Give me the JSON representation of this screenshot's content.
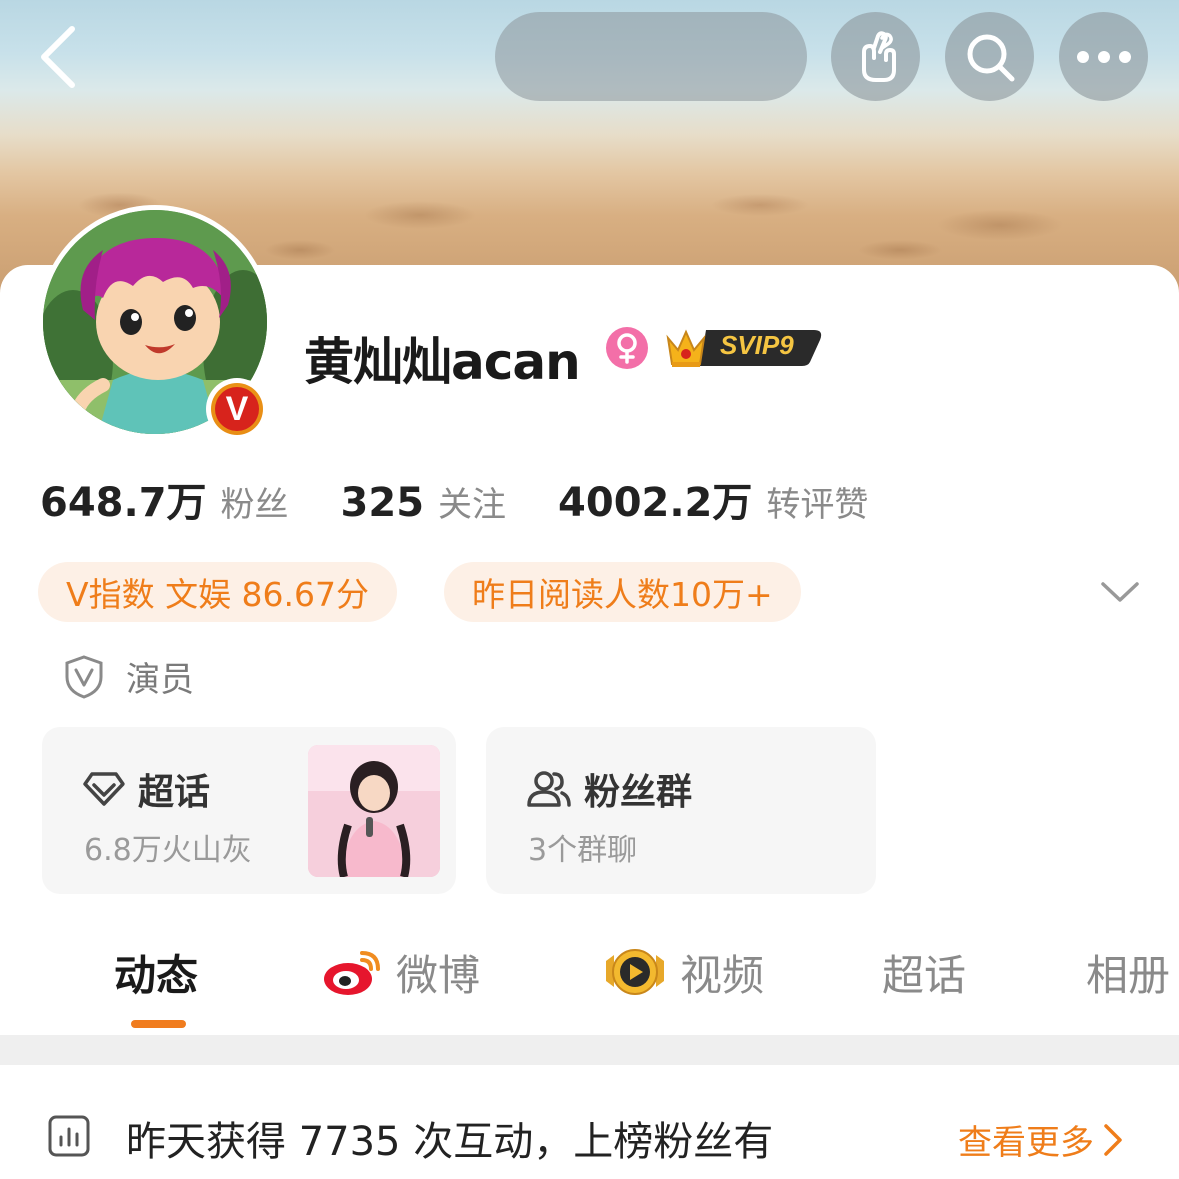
{
  "header": {
    "back_icon": "chevron-left-icon",
    "action_icons": [
      "hand-heart-icon",
      "search-icon",
      "more-icon"
    ]
  },
  "profile": {
    "username": "黄灿灿acan",
    "gender": "female",
    "vip_badge": "SVIP9",
    "verified_badge": "V"
  },
  "stats": [
    {
      "value": "648.7万",
      "label": "粉丝"
    },
    {
      "value": "325",
      "label": "关注"
    },
    {
      "value": "4002.2万",
      "label": "转评赞"
    }
  ],
  "tags": [
    {
      "label": "V指数 文娱 86.67分"
    },
    {
      "label": "昨日阅读人数10万+"
    }
  ],
  "role": {
    "label": "演员"
  },
  "cards": {
    "supertopic": {
      "title": "超话",
      "subtitle": "6.8万火山灰"
    },
    "fangroup": {
      "title": "粉丝群",
      "subtitle": "3个群聊"
    }
  },
  "tabs": [
    {
      "label": "动态",
      "active": true
    },
    {
      "label": "微博"
    },
    {
      "label": "视频"
    },
    {
      "label": "超话"
    },
    {
      "label": "相册"
    }
  ],
  "info_bar": {
    "text": "昨天获得 7735 次互动，上榜粉丝有",
    "more_label": "查看更多"
  },
  "colors": {
    "accent": "#ef7d1a",
    "tag_bg": "#fdf0e6",
    "gender": "#f36fa8"
  }
}
